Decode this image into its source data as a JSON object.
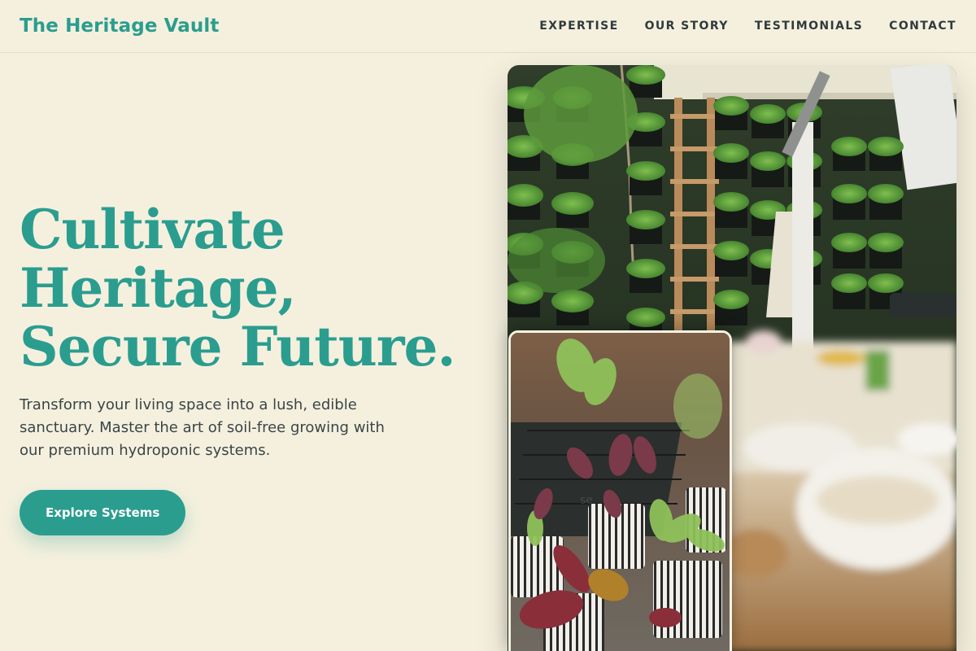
{
  "header": {
    "brand": "The Heritage Vault",
    "nav": [
      "EXPERTISE",
      "OUR STORY",
      "TESTIMONIALS",
      "CONTACT"
    ]
  },
  "hero": {
    "headline": [
      "Cultivate",
      "Heritage,",
      "Secure Future."
    ],
    "subtext": "Transform your living space into a lush, edible sanctuary. Master the art of soil-free growing with our premium hydroponic systems.",
    "cta_label": "Explore Systems"
  },
  "images": {
    "main": "vertical-garden-photo",
    "inset": "potted-seedlings-photo"
  },
  "colors": {
    "background": "#f5f0de",
    "accent": "#2a9d8f",
    "text": "#3a4548"
  }
}
